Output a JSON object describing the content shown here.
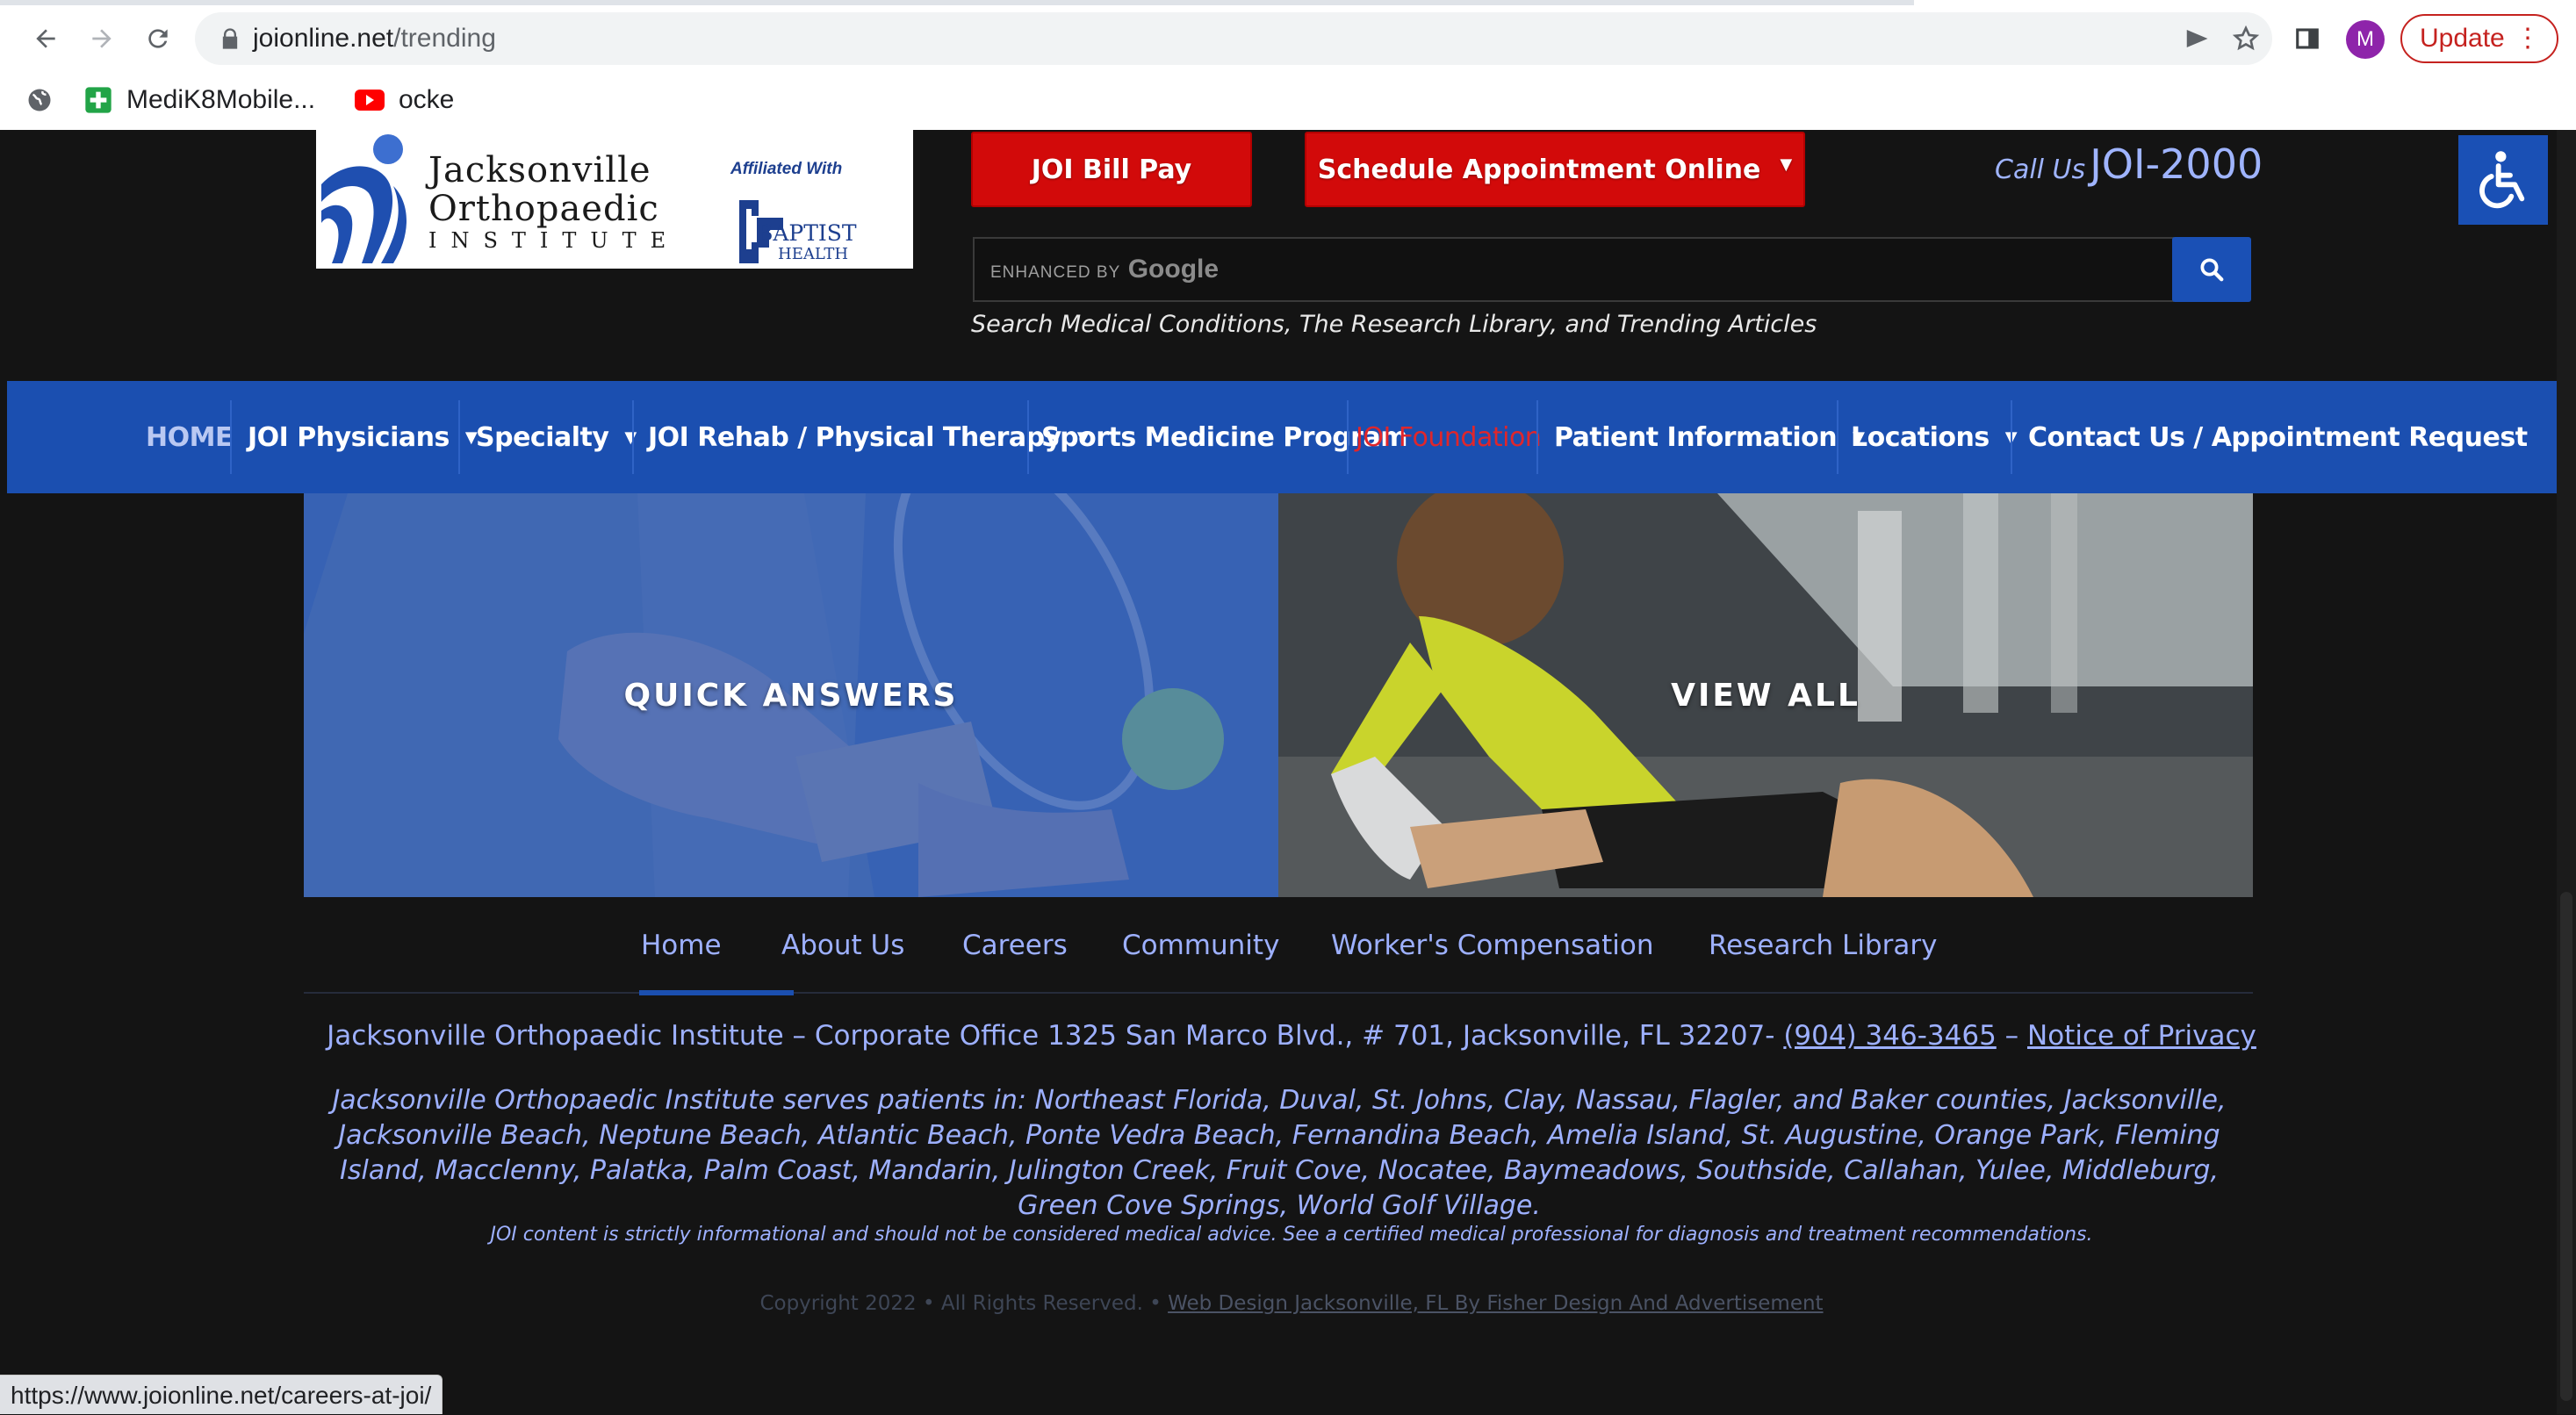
{
  "browser": {
    "url_domain": "joionline.net",
    "url_path": "/trending",
    "profile_initial": "M",
    "update_label": "Update",
    "bookmarks": [
      {
        "label": "MediK8Mobile...",
        "icon": "green-cross-icon"
      },
      {
        "label": "ocke",
        "icon": "youtube-icon"
      }
    ],
    "status_url": "https://www.joionline.net/careers-at-joi/"
  },
  "header": {
    "logo": {
      "line1": "Jacksonville",
      "line2": "Orthopaedic",
      "line3": "INSTITUTE",
      "affiliated": "Affiliated With",
      "partner_line1": "BAPTIST",
      "partner_line2": "HEALTH"
    },
    "bill_pay_label": "JOI Bill Pay",
    "schedule_label": "Schedule Appointment Online",
    "call_label": "Call Us",
    "call_number": "JOI-2000",
    "search": {
      "enhanced_by": "ENHANCED BY",
      "google": "Google",
      "hint": "Search Medical Conditions, The Research Library, and Trending Articles"
    }
  },
  "nav": {
    "items": [
      {
        "label": "HOME",
        "dropdown": false
      },
      {
        "label": "JOI Physicians",
        "dropdown": true
      },
      {
        "label": "Specialty",
        "dropdown": true
      },
      {
        "label": "JOI Rehab / Physical Therapy",
        "dropdown": true
      },
      {
        "label": "Sports Medicine Program",
        "dropdown": false
      },
      {
        "label": "JOI Foundation",
        "dropdown": false
      },
      {
        "label": "Patient Information",
        "dropdown": true
      },
      {
        "label": "Locations",
        "dropdown": true
      },
      {
        "label": "Contact Us / Appointment Request",
        "dropdown": false
      }
    ],
    "caret": "▼"
  },
  "tiles": {
    "left_label": "QUICK ANSWERS",
    "right_label": "VIEW ALL"
  },
  "footer": {
    "nav": [
      "Home",
      "About Us",
      "Careers",
      "Community",
      "Worker's Compensation",
      "Research Library"
    ],
    "active_nav": "Careers",
    "address_text": "Jacksonville Orthopaedic Institute – Corporate Office 1325 San Marco Blvd., # 701, Jacksonville, FL 32207- ",
    "phone": "(904) 346-3465",
    "dash": " – ",
    "privacy": "Notice of Privacy",
    "serves": "Jacksonville Orthopaedic Institute serves patients in: Northeast Florida, Duval, St. Johns, Clay, Nassau, Flagler, and Baker counties, Jacksonville, Jacksonville Beach, Neptune Beach, Atlantic Beach, Ponte Vedra Beach, Fernandina Beach, Amelia Island, St. Augustine, Orange Park, Fleming Island, Macclenny, Palatka, Palm Coast, Mandarin, Julington Creek, Fruit Cove, Nocatee, Baymeadows, Southside, Callahan, Yulee, Middleburg, Green Cove Springs, World Golf Village.",
    "disclaimer": "JOI content is strictly informational and should not be considered medical advice. See a certified medical professional for diagnosis and treatment recommendations.",
    "copyright": "Copyright 2022 • All Rights Reserved. • ",
    "design_credit": "Web Design Jacksonville, FL By Fisher Design And Advertisement"
  },
  "colors": {
    "nav_blue": "#1b4fb0",
    "button_red": "#d20a0a",
    "link_blue": "#9db0ff",
    "foundation_red": "#e0262b",
    "page_bg": "#141414"
  }
}
